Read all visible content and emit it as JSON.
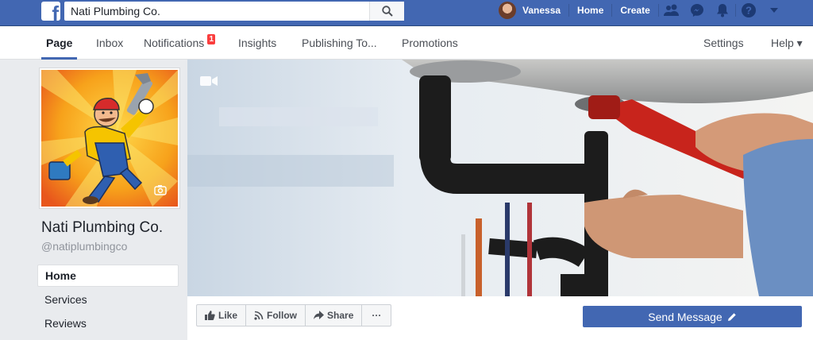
{
  "topbar": {
    "search_value": "Nati Plumbing Co.",
    "user_name": "Vanessa",
    "home_label": "Home",
    "create_label": "Create"
  },
  "tabs": [
    {
      "label": "Page",
      "active": true
    },
    {
      "label": "Inbox"
    },
    {
      "label": "Notifications",
      "badge": "1"
    },
    {
      "label": "Insights"
    },
    {
      "label": "Publishing To..."
    },
    {
      "label": "Promotions"
    },
    {
      "label": "Settings"
    },
    {
      "label": "Help ▾"
    }
  ],
  "page": {
    "name": "Nati Plumbing Co.",
    "handle": "@natiplumbingco",
    "nav": [
      {
        "label": "Home",
        "active": true
      },
      {
        "label": "Services"
      },
      {
        "label": "Reviews"
      }
    ]
  },
  "actions": {
    "like": "Like",
    "follow": "Follow",
    "share": "Share",
    "more": "···",
    "send_message": "Send Message"
  },
  "colors": {
    "brand_blue": "#4267b2",
    "notification_red": "#fa3e3e",
    "page_bg": "#e9ebee"
  },
  "icons": [
    "facebook-logo-icon",
    "search-icon",
    "friends-icon",
    "messenger-icon",
    "bell-icon",
    "help-icon",
    "caret-down-icon",
    "video-camera-icon",
    "camera-icon",
    "thumbs-up-icon",
    "rss-icon",
    "share-arrow-icon",
    "pencil-icon"
  ]
}
